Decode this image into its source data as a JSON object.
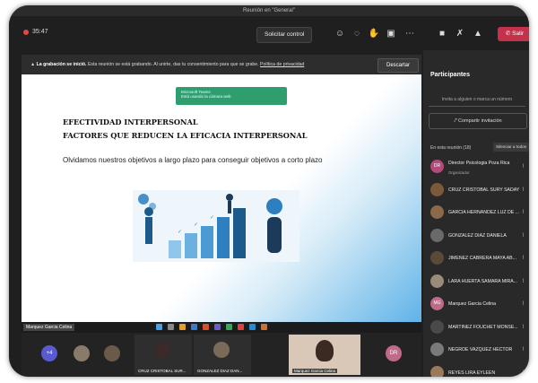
{
  "window": {
    "title": "Reunión en \"General\""
  },
  "toolbar": {
    "timer": "35:47",
    "control_label": "Solicitar control",
    "leave_label": "Salir"
  },
  "banner": {
    "bold_text": "La grabación se inició.",
    "text": "Esta reunión se está grabando. Al unirte, das tu consentimiento para que se grabe.",
    "link_text": "Política de privacidad",
    "dismiss_label": "Descartar"
  },
  "slide": {
    "title": "EFECTIVIDAD INTERPERSONAL",
    "subtitle": "FACTORES QUE REDUCEN LA EFICACIA INTERPERSONAL",
    "body": "Olvidamos nuestros objetivos a largo plazo para conseguir objetivos a corto plazo"
  },
  "notification": {
    "line1": "Microsoft Teams",
    "line2": "Está usando la cámara web"
  },
  "presenter_label": "Marquez Garcia Celina",
  "sidebar": {
    "title": "Participantes",
    "invite_placeholder": "Invita a alguien o marca un número",
    "share_label": "Compartir invitación",
    "in_meeting_label": "En esta reunión (18)",
    "mute_all_label": "Silenciar a todos"
  },
  "participants": [
    {
      "name": "Director Psicologia Poza Rica",
      "role": "Organizador",
      "color": "#b24a7a",
      "initials": "DR"
    },
    {
      "name": "CRUZ CRISTOBAL SURY SADAY",
      "role": "",
      "color": "#7a5a3a",
      "initials": ""
    },
    {
      "name": "GARCIA HERNANDEZ LUZ DE ...",
      "role": "",
      "color": "#8a6a4a",
      "initials": ""
    },
    {
      "name": "GONZALEZ DIAZ DANIELA",
      "role": "",
      "color": "#6a6a6a",
      "initials": ""
    },
    {
      "name": "JIMENEZ CABRERA MAYA AB...",
      "role": "",
      "color": "#5a4a3a",
      "initials": ""
    },
    {
      "name": "LARA HUERTA SAMARA MIRA...",
      "role": "",
      "color": "#9a8a7a",
      "initials": ""
    },
    {
      "name": "Marquez Garcia Celina",
      "role": "",
      "color": "#c06a8a",
      "initials": "MG"
    },
    {
      "name": "MARTINEZ FOUCHET MONSE...",
      "role": "",
      "color": "#4a4a4a",
      "initials": ""
    },
    {
      "name": "NEGROE VAZQUEZ HECTOR",
      "role": "",
      "color": "#7a7a7a",
      "initials": ""
    },
    {
      "name": "REYES LIRA EYLEEN",
      "role": "",
      "color": "#9a7a5a",
      "initials": ""
    }
  ],
  "bottom": {
    "more_count": "+4",
    "tile1_label": "CRUZ CRISTOBAL SUR...",
    "tile2_label": "GONZALEZ DIAZ DAN...",
    "tile3_label": "Marquez Garcia Celina",
    "avatar_dr": "DR"
  }
}
